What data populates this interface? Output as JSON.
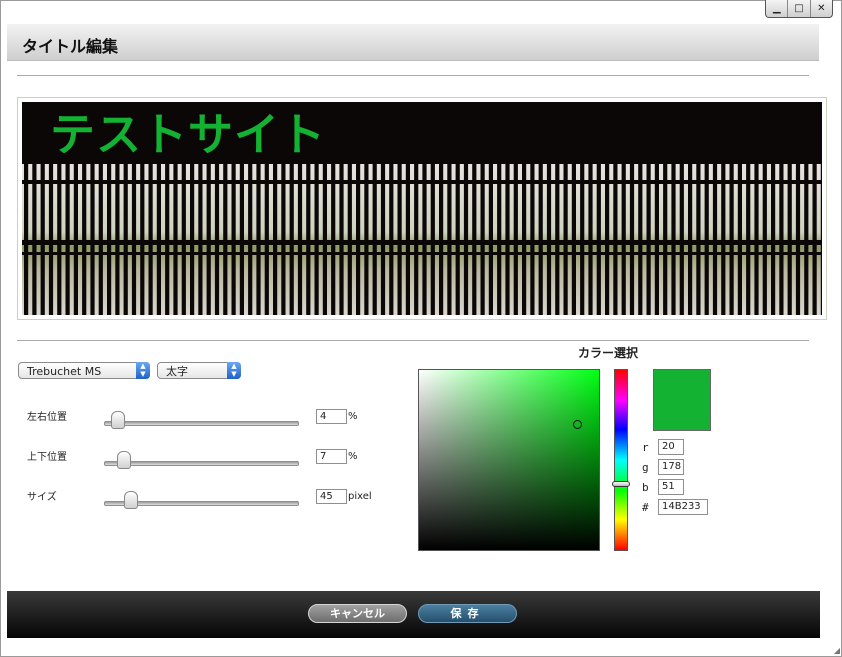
{
  "window": {
    "title": "タイトル編集",
    "controls": {
      "minimize_icon": "minimize-icon",
      "maximize_icon": "maximize-icon",
      "close_icon": "close-icon"
    }
  },
  "preview": {
    "title_text": "テストサイト",
    "title_color": "#14B233",
    "title_offset_x_percent": 4,
    "title_offset_y_percent": 7,
    "title_size_px": 45
  },
  "font": {
    "family_selected": "Trebuchet MS",
    "weight_selected": "太字"
  },
  "sliders": {
    "horizontal": {
      "label": "左右位置",
      "value": "4",
      "unit": "%",
      "level_percent": 4
    },
    "vertical": {
      "label": "上下位置",
      "value": "7",
      "unit": "%",
      "level_percent": 7
    },
    "size": {
      "label": "サイズ",
      "value": "45",
      "unit": "pixel",
      "level_percent": 11
    }
  },
  "color_picker": {
    "heading": "カラー選択",
    "r_label": "r",
    "r": "20",
    "g_label": "g",
    "g": "178",
    "b_label": "b",
    "b": "51",
    "hex_label": "#",
    "hex": "14B233",
    "swatch_color": "#14B233",
    "hue_color": "#00ff14"
  },
  "footer": {
    "cancel_label": "キャンセル",
    "save_label": "保存"
  },
  "colors": {
    "footer_bg": "#050505",
    "save_button": "#24506d",
    "cancel_button": "#6e6e6e"
  }
}
